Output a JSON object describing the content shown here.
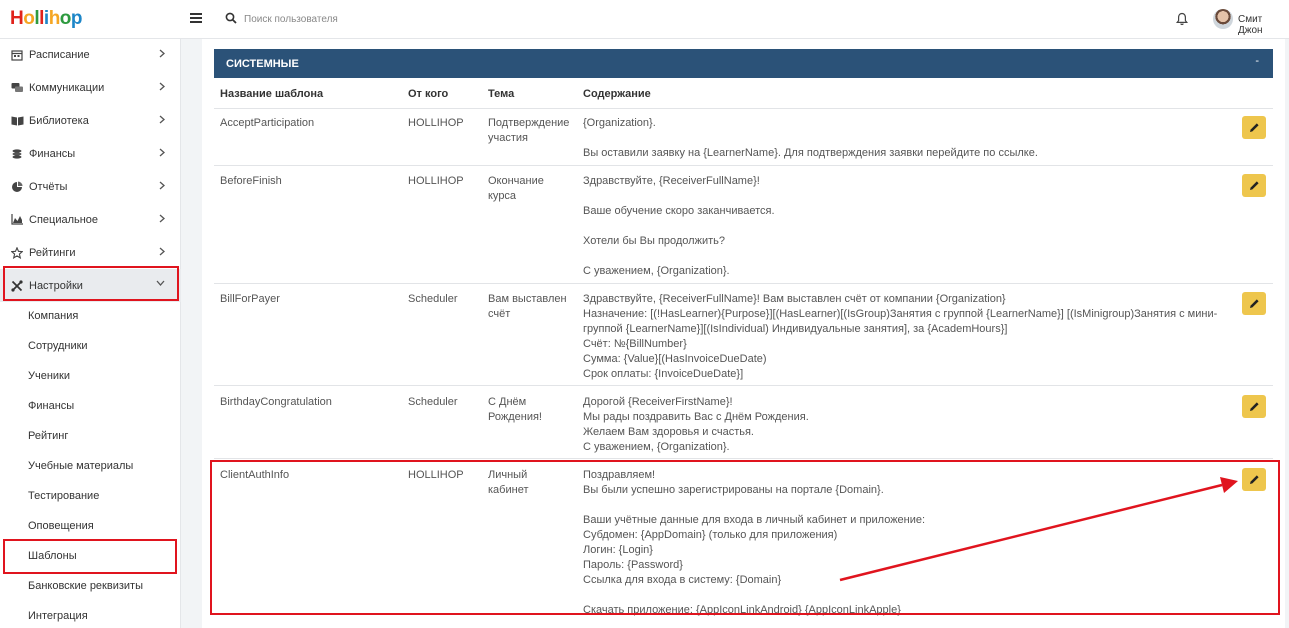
{
  "topbar": {
    "logo": [
      "H",
      "o",
      "l",
      "l",
      "i",
      "h",
      "o",
      "p"
    ],
    "logo_colors": [
      "#e0231c",
      "#f5a623",
      "#2e9a3f",
      "#e0231c",
      "#1d86c8",
      "#f5a623",
      "#2e9a3f",
      "#1d86c8"
    ],
    "search_placeholder": "Поиск пользователя",
    "user_name": "Смит Джон"
  },
  "sidebar": {
    "items": [
      {
        "label": "Расписание",
        "icon": "calendar-icon"
      },
      {
        "label": "Коммуникации",
        "icon": "chat-icon"
      },
      {
        "label": "Библиотека",
        "icon": "book-icon"
      },
      {
        "label": "Финансы",
        "icon": "coins-icon"
      },
      {
        "label": "Отчёты",
        "icon": "pie-chart-icon"
      },
      {
        "label": "Специальное",
        "icon": "area-chart-icon"
      },
      {
        "label": "Рейтинги",
        "icon": "star-icon"
      },
      {
        "label": "Настройки",
        "icon": "tools-icon"
      }
    ],
    "subitems": [
      "Компания",
      "Сотрудники",
      "Ученики",
      "Финансы",
      "Рейтинг",
      "Учебные материалы",
      "Тестирование",
      "Оповещения",
      "Шаблоны",
      "Банковские реквизиты",
      "Интеграция"
    ]
  },
  "panel": {
    "title": "СИСТЕМНЫЕ",
    "collapse_label": "-",
    "columns": {
      "name": "Название шаблона",
      "from": "От кого",
      "subject": "Тема",
      "content": "Содержание"
    },
    "rows": [
      {
        "name": "AcceptParticipation",
        "from": "HOLLIHOP",
        "subject": "Подтверждение\nучастия",
        "content": "{Organization}.\n\nВы оставили заявку на {LearnerName}. Для подтверждения заявки перейдите по ссылке."
      },
      {
        "name": "BeforeFinish",
        "from": "HOLLIHOP",
        "subject": "Окончание\nкурса",
        "content": "Здравствуйте, {ReceiverFullName}!\n\nВаше обучение скоро заканчивается.\n\nХотели бы Вы продолжить?\n\nС уважением, {Organization}."
      },
      {
        "name": "BillForPayer",
        "from": "Scheduler",
        "subject": "Вам выставлен\nсчёт",
        "content": "Здравствуйте, {ReceiverFullName}! Вам выставлен счёт от компании {Organization}\nНазначение: [(!HasLearner){Purpose}][(HasLearner)[(IsGroup)Занятия с группой {LearnerName}] [(IsMinigroup)Занятия с мини-\nгруппой {LearnerName}][(IsIndividual) Индивидуальные занятия], за {AcademHours}]\nСчёт: №{BillNumber}\nСумма: {Value}[(HasInvoiceDueDate)\nСрок оплаты: {InvoiceDueDate}]"
      },
      {
        "name": "BirthdayCongratulation",
        "from": "Scheduler",
        "subject": "С Днём\nРождения!",
        "content": "Дорогой {ReceiverFirstName}!\nМы рады поздравить Вас с Днём Рождения.\nЖелаем Вам здоровья и счастья.\nС уважением, {Organization}."
      },
      {
        "name": "ClientAuthInfo",
        "from": "HOLLIHOP",
        "subject": "Личный\nкабинет",
        "content": "Поздравляем!\nВы были успешно зарегистрированы на портале {Domain}.\n\nВаши учётные данные для входа в личный кабинет и приложение:\nСубдомен: {AppDomain} (только для приложения)\nЛогин: {Login}\nПароль: {Password}\nСсылка для входа в систему: {Domain}\n\nСкачать приложение: {AppIconLinkAndroid}  {AppIconLinkApple}"
      }
    ]
  }
}
